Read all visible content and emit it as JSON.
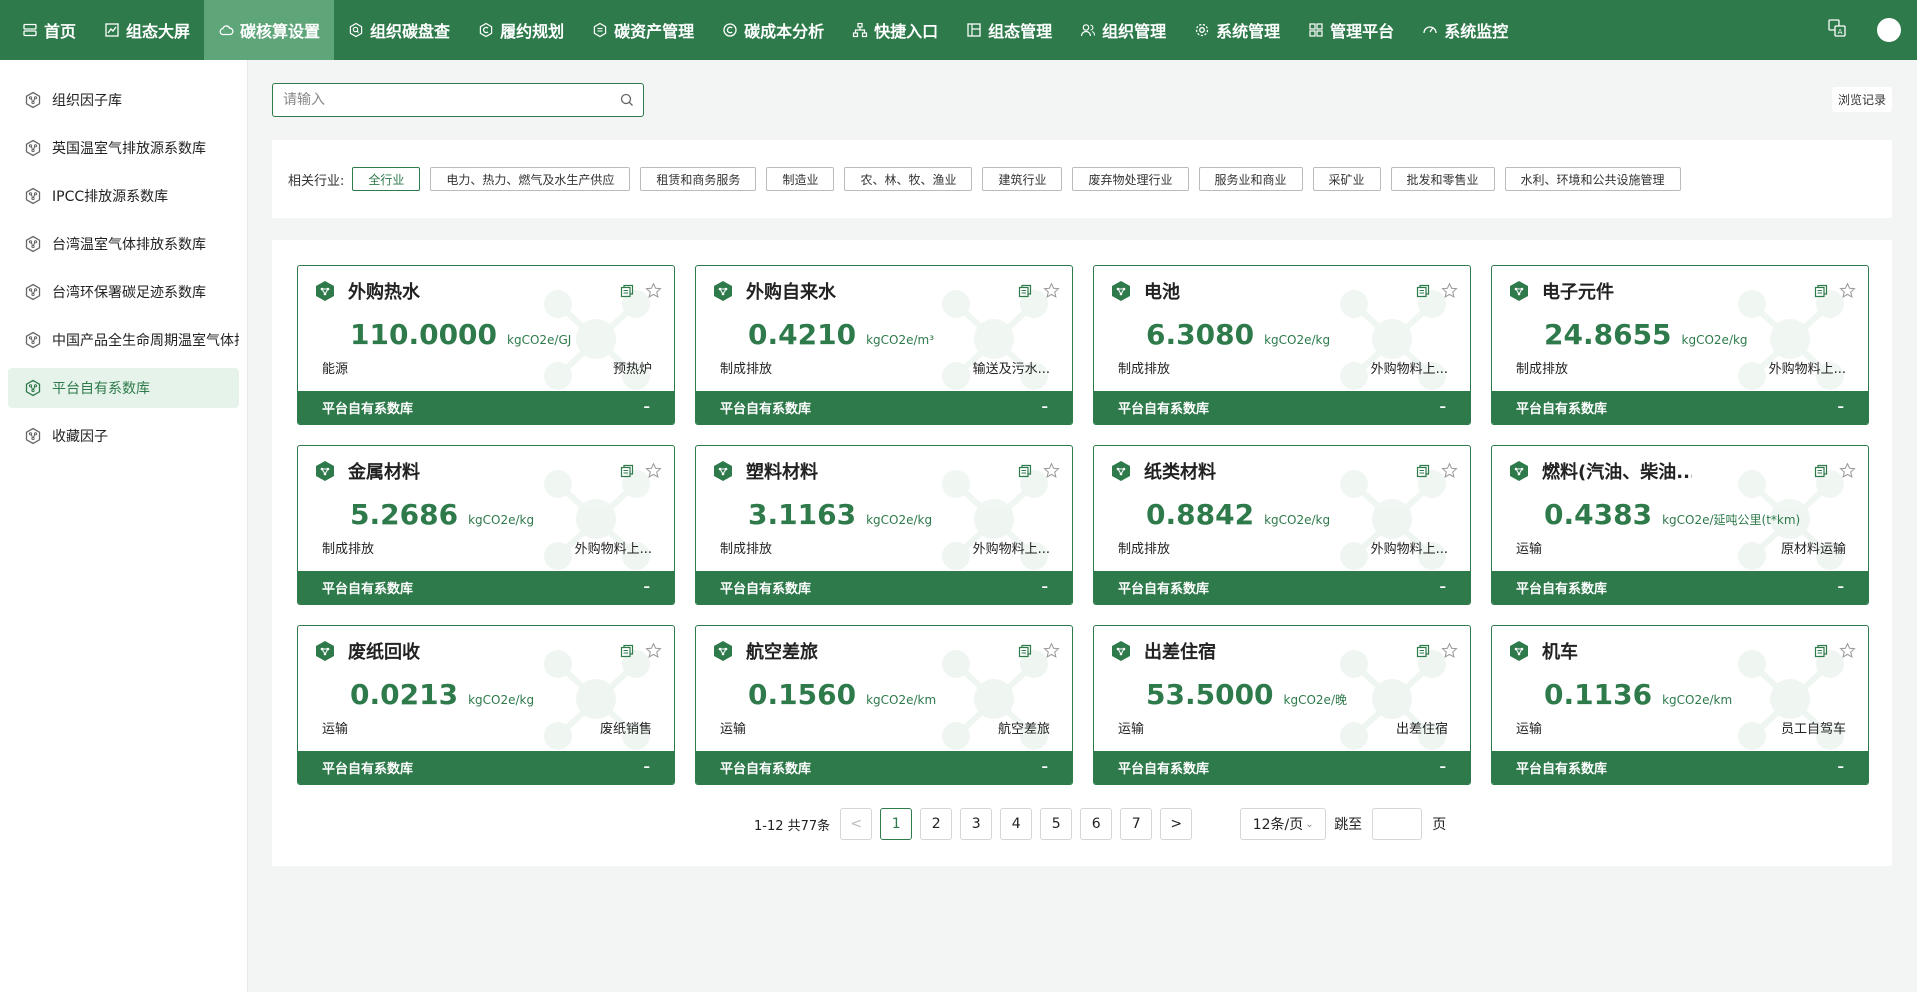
{
  "nav": {
    "items": [
      {
        "label": "首页",
        "icon": "server-icon",
        "active": false
      },
      {
        "label": "组态大屏",
        "icon": "chart-line-icon",
        "active": false
      },
      {
        "label": "碳核算设置",
        "icon": "cloud-icon",
        "active": true
      },
      {
        "label": "组织碳盘查",
        "icon": "hex-search-icon",
        "active": false
      },
      {
        "label": "履约规划",
        "icon": "hex-c-icon",
        "active": false
      },
      {
        "label": "碳资产管理",
        "icon": "database-icon",
        "active": false
      },
      {
        "label": "碳成本分析",
        "icon": "circle-c-icon",
        "active": false
      },
      {
        "label": "快捷入口",
        "icon": "sitemap-icon",
        "active": false
      },
      {
        "label": "组态管理",
        "icon": "layout-icon",
        "active": false
      },
      {
        "label": "组织管理",
        "icon": "users-icon",
        "active": false
      },
      {
        "label": "系统管理",
        "icon": "gear-icon",
        "active": false
      },
      {
        "label": "管理平台",
        "icon": "grid-icon",
        "active": false
      },
      {
        "label": "系统监控",
        "icon": "gauge-icon",
        "active": false
      }
    ]
  },
  "sidebar": {
    "items": [
      {
        "label": "组织因子库",
        "active": false
      },
      {
        "label": "英国温室气排放源系数库",
        "active": false
      },
      {
        "label": "IPCC排放源系数库",
        "active": false
      },
      {
        "label": "台湾温室气体排放系数库",
        "active": false
      },
      {
        "label": "台湾环保署碳足迹系数库",
        "active": false
      },
      {
        "label": "中国产品全生命周期温室气体排放系数库",
        "active": false
      },
      {
        "label": "平台自有系数库",
        "active": true
      },
      {
        "label": "收藏因子",
        "active": false
      }
    ]
  },
  "search": {
    "placeholder": "请输入",
    "history_label": "浏览记录"
  },
  "filter": {
    "label": "相关行业:",
    "tags": [
      {
        "label": "全行业",
        "active": true
      },
      {
        "label": "电力、热力、燃气及水生产供应",
        "active": false
      },
      {
        "label": "租赁和商务服务",
        "active": false
      },
      {
        "label": "制造业",
        "active": false
      },
      {
        "label": "农、林、牧、渔业",
        "active": false
      },
      {
        "label": "建筑行业",
        "active": false
      },
      {
        "label": "废弃物处理行业",
        "active": false
      },
      {
        "label": "服务业和商业",
        "active": false
      },
      {
        "label": "采矿业",
        "active": false
      },
      {
        "label": "批发和零售业",
        "active": false
      },
      {
        "label": "水利、环境和公共设施管理",
        "active": false
      }
    ]
  },
  "cards": [
    {
      "title": "外购热水",
      "value": "110.0000",
      "unit": "kgCO2e/GJ",
      "scope": "能源",
      "category": "预热炉",
      "source": "平台自有系数库",
      "extra": "–"
    },
    {
      "title": "外购自来水",
      "value": "0.4210",
      "unit": "kgCO2e/m³",
      "scope": "制成排放",
      "category": "输送及污水...",
      "source": "平台自有系数库",
      "extra": "–"
    },
    {
      "title": "电池",
      "value": "6.3080",
      "unit": "kgCO2e/kg",
      "scope": "制成排放",
      "category": "外购物料上...",
      "source": "平台自有系数库",
      "extra": "–"
    },
    {
      "title": "电子元件",
      "value": "24.8655",
      "unit": "kgCO2e/kg",
      "scope": "制成排放",
      "category": "外购物料上...",
      "source": "平台自有系数库",
      "extra": "–"
    },
    {
      "title": "金属材料",
      "value": "5.2686",
      "unit": "kgCO2e/kg",
      "scope": "制成排放",
      "category": "外购物料上...",
      "source": "平台自有系数库",
      "extra": "–"
    },
    {
      "title": "塑料材料",
      "value": "3.1163",
      "unit": "kgCO2e/kg",
      "scope": "制成排放",
      "category": "外购物料上...",
      "source": "平台自有系数库",
      "extra": "–"
    },
    {
      "title": "纸类材料",
      "value": "0.8842",
      "unit": "kgCO2e/kg",
      "scope": "制成排放",
      "category": "外购物料上...",
      "source": "平台自有系数库",
      "extra": "–"
    },
    {
      "title": "燃料(汽油、柴油...",
      "value": "0.4383",
      "unit": "kgCO2e/延吨公里(t*km)",
      "scope": "运输",
      "category": "原材料运输",
      "source": "平台自有系数库",
      "extra": "–"
    },
    {
      "title": "废纸回收",
      "value": "0.0213",
      "unit": "kgCO2e/kg",
      "scope": "运输",
      "category": "废纸销售",
      "source": "平台自有系数库",
      "extra": "–"
    },
    {
      "title": "航空差旅",
      "value": "0.1560",
      "unit": "kgCO2e/km",
      "scope": "运输",
      "category": "航空差旅",
      "source": "平台自有系数库",
      "extra": "–"
    },
    {
      "title": "出差住宿",
      "value": "53.5000",
      "unit": "kgCO2e/晚",
      "scope": "运输",
      "category": "出差住宿",
      "source": "平台自有系数库",
      "extra": "–"
    },
    {
      "title": "机车",
      "value": "0.1136",
      "unit": "kgCO2e/km",
      "scope": "运输",
      "category": "员工自驾车",
      "source": "平台自有系数库",
      "extra": "–"
    }
  ],
  "pagination": {
    "total_text": "1-12 共77条",
    "prev": "<",
    "next": ">",
    "pages": [
      "1",
      "2",
      "3",
      "4",
      "5",
      "6",
      "7"
    ],
    "current": "1",
    "page_size": "12条/页",
    "jump_label": "跳至",
    "jump_suffix": "页"
  },
  "colors": {
    "brand": "#2e7a4b",
    "nav_active": "#5ea57a",
    "sidebar_active_bg": "#e6f3ea"
  }
}
